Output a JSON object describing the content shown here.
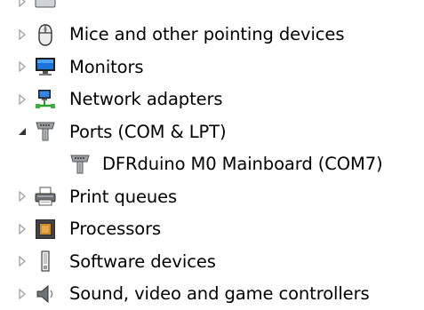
{
  "tree": {
    "items": [
      {
        "label": "",
        "icon": "keyboard-icon",
        "expander": "collapsed"
      },
      {
        "label": "Mice and other pointing devices",
        "icon": "mouse-icon",
        "expander": "collapsed"
      },
      {
        "label": "Monitors",
        "icon": "monitor-icon",
        "expander": "collapsed"
      },
      {
        "label": "Network adapters",
        "icon": "network-adapter-icon",
        "expander": "collapsed"
      },
      {
        "label": "Ports (COM & LPT)",
        "icon": "port-icon",
        "expander": "expanded"
      },
      {
        "label": "DFRduino M0 Mainboard (COM7)",
        "icon": "port-icon",
        "expander": "none",
        "child": true
      },
      {
        "label": "Print queues",
        "icon": "printer-icon",
        "expander": "collapsed"
      },
      {
        "label": "Processors",
        "icon": "processor-icon",
        "expander": "collapsed"
      },
      {
        "label": "Software devices",
        "icon": "software-device-icon",
        "expander": "collapsed"
      },
      {
        "label": "Sound, video and game controllers",
        "icon": "speaker-icon",
        "expander": "collapsed"
      }
    ]
  }
}
